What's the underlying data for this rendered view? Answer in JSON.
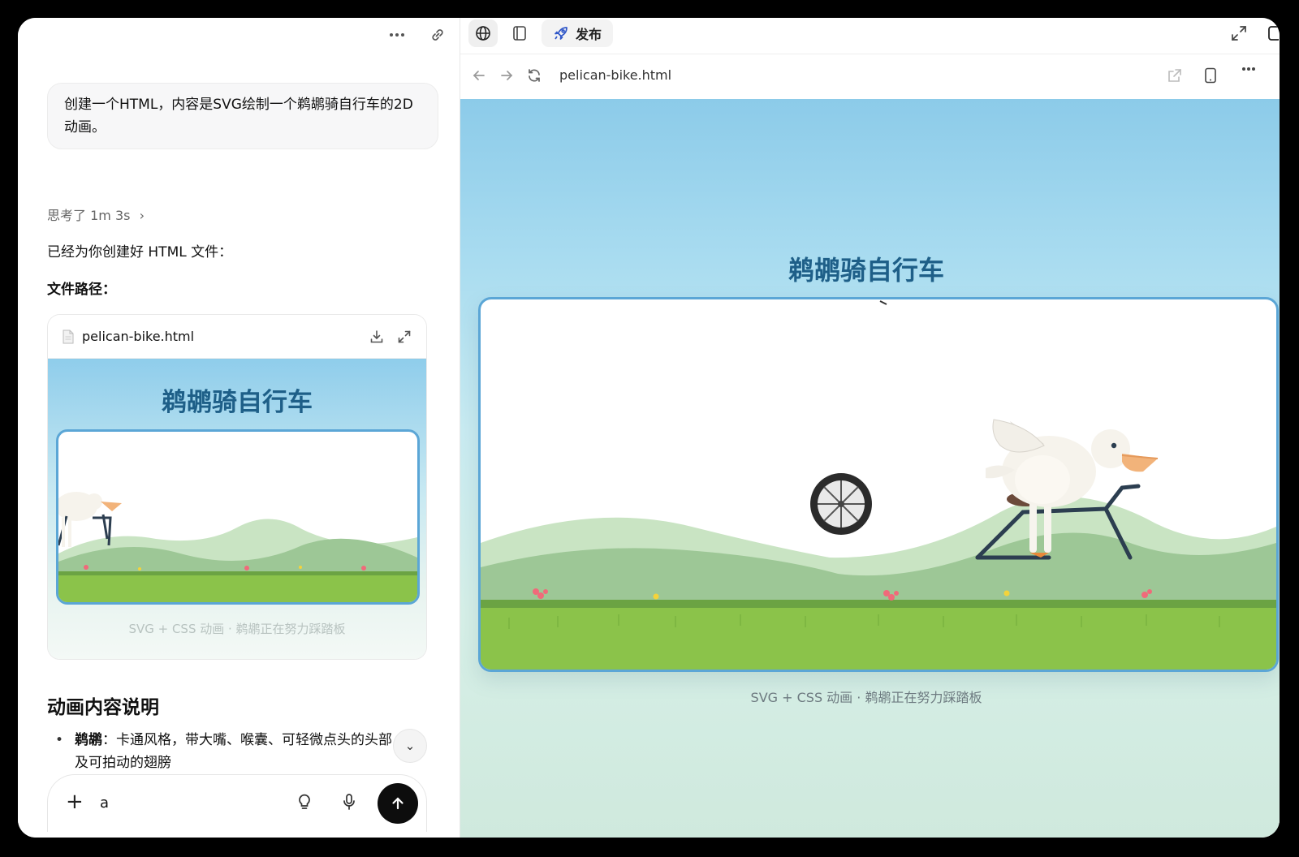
{
  "chat": {
    "user_message": "创建一个HTML，内容是SVG绘制一个鹈鹕骑自行车的2D动画。",
    "thinking_label": "思考了 1m 3s",
    "reply_intro": "已经为你创建好 HTML 文件：",
    "path_label": "文件路径：",
    "file_card": {
      "file_name": "pelican-bike.html",
      "preview_title": "鹈鹕骑自行车",
      "preview_caption": "SVG + CSS 动画 · 鹈鹕正在努力踩踏板"
    },
    "section_title": "动画内容说明",
    "bullet_bold": "鹈鹕",
    "bullet_text": "：卡通风格，带大嘴、喉囊、可轻微点头的头部，以及可拍动的翅膀",
    "composer_text": "a"
  },
  "preview": {
    "publish_label": "发布",
    "url": "pelican-bike.html",
    "page_title": "鹈鹕骑自行车",
    "page_caption": "SVG + CSS 动画 · 鹈鹕正在努力踩踏板"
  },
  "colors": {
    "title_blue": "#1e5f88",
    "stage_border": "#5ba6d6",
    "grass": "#8bc34a",
    "hill_light": "#c9e4c3",
    "hill_dark": "#9dc796"
  }
}
